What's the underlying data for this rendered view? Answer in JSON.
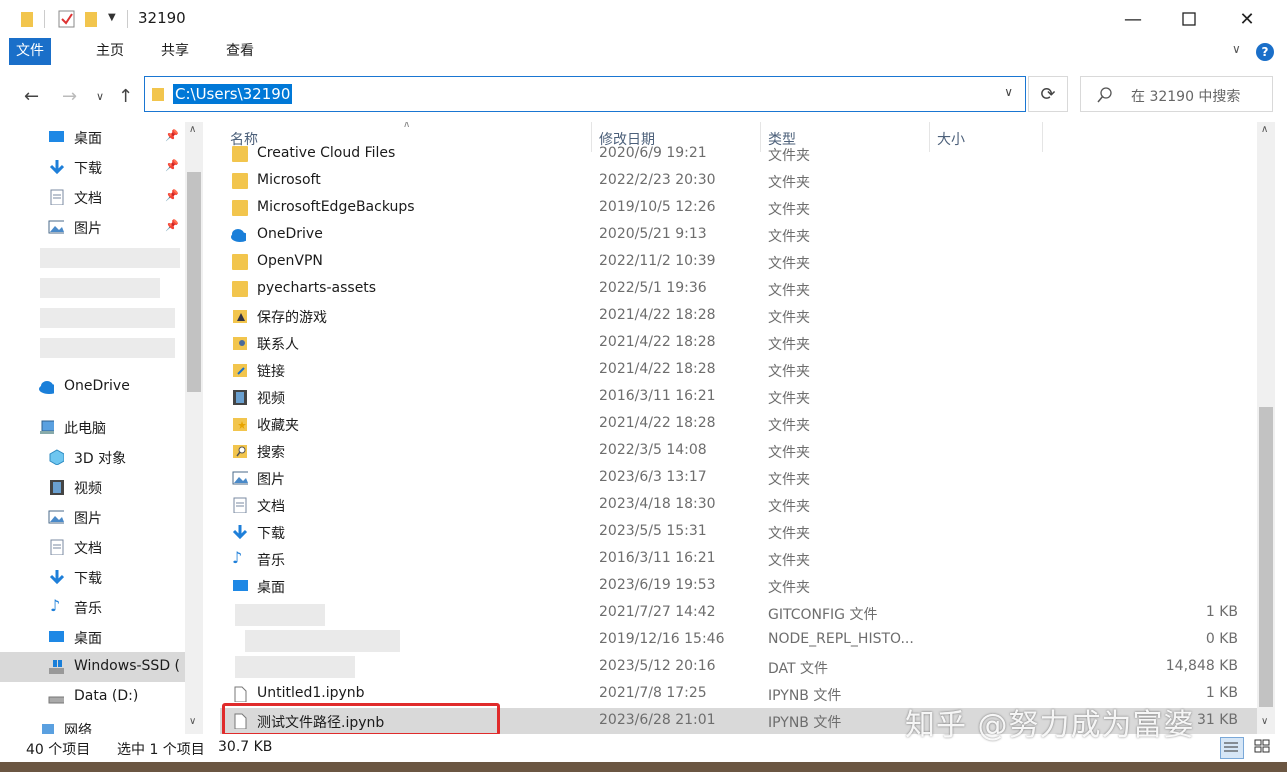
{
  "window": {
    "title": "32190"
  },
  "ribbon": {
    "tabs": [
      "文件",
      "主页",
      "共享",
      "查看"
    ]
  },
  "address": {
    "path": "C:\\Users\\32190"
  },
  "search": {
    "placeholder": "在 32190 中搜索"
  },
  "sidebar": {
    "items": [
      {
        "label": "桌面",
        "icon": "desktop-icon",
        "pinned": true
      },
      {
        "label": "下载",
        "icon": "download-icon",
        "pinned": true
      },
      {
        "label": "文档",
        "icon": "document-icon",
        "pinned": true
      },
      {
        "label": "图片",
        "icon": "picture-icon",
        "pinned": true
      },
      {
        "label": "OneDrive",
        "icon": "onedrive-icon"
      },
      {
        "label": "此电脑",
        "icon": "computer-icon"
      },
      {
        "label": "3D 对象",
        "icon": "cube-icon"
      },
      {
        "label": "视频",
        "icon": "video-icon"
      },
      {
        "label": "图片",
        "icon": "picture-icon"
      },
      {
        "label": "文档",
        "icon": "document-icon"
      },
      {
        "label": "下载",
        "icon": "download-icon"
      },
      {
        "label": "音乐",
        "icon": "music-icon"
      },
      {
        "label": "桌面",
        "icon": "desktop-icon"
      },
      {
        "label": "Windows-SSD (",
        "icon": "windows-drive-icon",
        "selected": true
      },
      {
        "label": "Data (D:)",
        "icon": "drive-icon"
      },
      {
        "label": "网络",
        "icon": "network-icon"
      }
    ]
  },
  "columns": {
    "name": "名称",
    "date": "修改日期",
    "type": "类型",
    "size": "大小"
  },
  "files": [
    {
      "name": "Creative Cloud Files",
      "date": "2020/6/9 19:21",
      "type": "文件夹",
      "size": "",
      "icon": "folder-icon"
    },
    {
      "name": "Microsoft",
      "date": "2022/2/23 20:30",
      "type": "文件夹",
      "size": "",
      "icon": "folder-icon"
    },
    {
      "name": "MicrosoftEdgeBackups",
      "date": "2019/10/5 12:26",
      "type": "文件夹",
      "size": "",
      "icon": "folder-icon"
    },
    {
      "name": "OneDrive",
      "date": "2020/5/21 9:13",
      "type": "文件夹",
      "size": "",
      "icon": "onedrive-icon"
    },
    {
      "name": "OpenVPN",
      "date": "2022/11/2 10:39",
      "type": "文件夹",
      "size": "",
      "icon": "folder-icon"
    },
    {
      "name": "pyecharts-assets",
      "date": "2022/5/1 19:36",
      "type": "文件夹",
      "size": "",
      "icon": "folder-icon"
    },
    {
      "name": "保存的游戏",
      "date": "2021/4/22 18:28",
      "type": "文件夹",
      "size": "",
      "icon": "saved-games-icon"
    },
    {
      "name": "联系人",
      "date": "2021/4/22 18:28",
      "type": "文件夹",
      "size": "",
      "icon": "contacts-icon"
    },
    {
      "name": "链接",
      "date": "2021/4/22 18:28",
      "type": "文件夹",
      "size": "",
      "icon": "links-icon"
    },
    {
      "name": "视频",
      "date": "2016/3/11 16:21",
      "type": "文件夹",
      "size": "",
      "icon": "video-icon"
    },
    {
      "name": "收藏夹",
      "date": "2021/4/22 18:28",
      "type": "文件夹",
      "size": "",
      "icon": "favorites-icon"
    },
    {
      "name": "搜索",
      "date": "2022/3/5 14:08",
      "type": "文件夹",
      "size": "",
      "icon": "search-folder-icon"
    },
    {
      "name": "图片",
      "date": "2023/6/3 13:17",
      "type": "文件夹",
      "size": "",
      "icon": "picture-icon"
    },
    {
      "name": "文档",
      "date": "2023/4/18 18:30",
      "type": "文件夹",
      "size": "",
      "icon": "document-icon"
    },
    {
      "name": "下载",
      "date": "2023/5/5 15:31",
      "type": "文件夹",
      "size": "",
      "icon": "download-icon"
    },
    {
      "name": "音乐",
      "date": "2016/3/11 16:21",
      "type": "文件夹",
      "size": "",
      "icon": "music-icon"
    },
    {
      "name": "桌面",
      "date": "2023/6/19 19:53",
      "type": "文件夹",
      "size": "",
      "icon": "desktop-icon"
    },
    {
      "name": "",
      "date": "2021/7/27 14:42",
      "type": "GITCONFIG 文件",
      "size": "1 KB",
      "icon": "blurred"
    },
    {
      "name": "",
      "date": "2019/12/16 15:46",
      "type": "NODE_REPL_HISTO...",
      "size": "0 KB",
      "icon": "blurred"
    },
    {
      "name": "",
      "date": "2023/5/12 20:16",
      "type": "DAT 文件",
      "size": "14,848 KB",
      "icon": "blurred"
    },
    {
      "name": "Untitled1.ipynb",
      "date": "2021/7/8 17:25",
      "type": "IPYNB 文件",
      "size": "1 KB",
      "icon": "file-icon"
    },
    {
      "name": "测试文件路径.ipynb",
      "date": "2023/6/28 21:01",
      "type": "IPYNB 文件",
      "size": "31 KB",
      "icon": "file-icon",
      "selected": true
    }
  ],
  "status": {
    "count": "40 个项目",
    "selection": "选中 1 个项目",
    "size": "30.7 KB"
  },
  "watermark": "知乎 @努力成为富婆"
}
